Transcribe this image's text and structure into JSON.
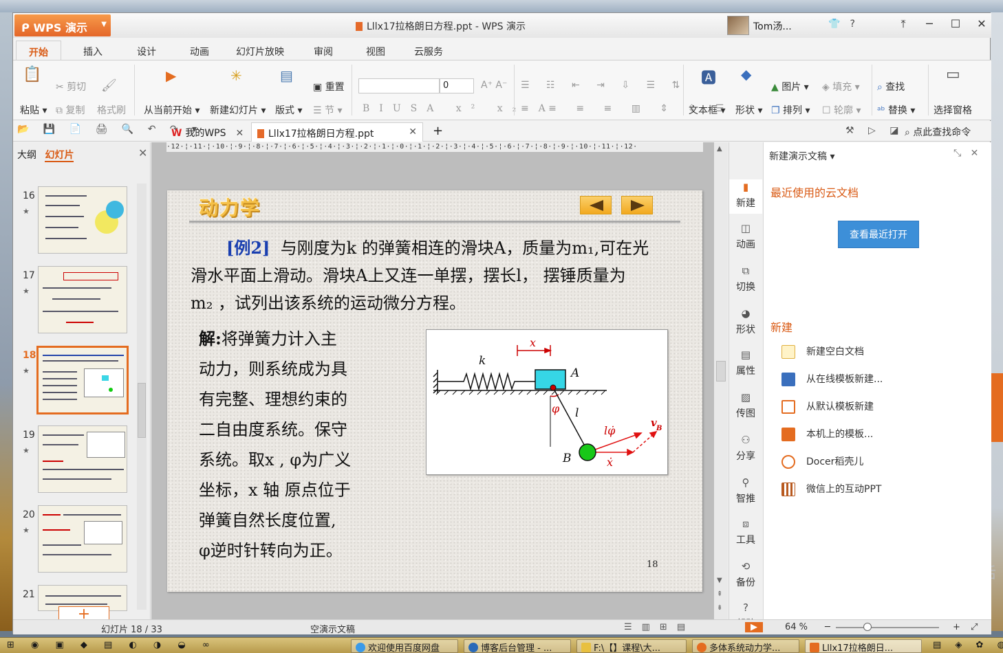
{
  "window": {
    "app_name": "WPS 演示",
    "title": "Lllx17拉格朗日方程.ppt - WPS 演示",
    "user_name": "Tom汤..."
  },
  "menu_tabs": [
    "开始",
    "插入",
    "设计",
    "动画",
    "幻灯片放映",
    "审阅",
    "视图",
    "云服务"
  ],
  "ribbon": {
    "paste": "粘贴",
    "cut": "剪切",
    "copy": "复制",
    "format_painter": "格式刷",
    "from_current": "从当前开始",
    "new_slide": "新建幻灯片",
    "layout": "版式",
    "reset": "重置",
    "section": "节",
    "font_size": "0",
    "textbox": "文本框",
    "shape": "形状",
    "picture": "图片",
    "fill": "填充",
    "arrange": "排列",
    "outline": "轮廓",
    "find": "查找",
    "replace": "替换",
    "select_pane": "选择窗格"
  },
  "doc_tabs": {
    "home": "我的WPS",
    "doc": "Lllx17拉格朗日方程.ppt",
    "search": "点此查找命令"
  },
  "left_panel": {
    "tab_outline": "大纲",
    "tab_slides": "幻灯片",
    "slides": [
      {
        "num": "16"
      },
      {
        "num": "17"
      },
      {
        "num": "18"
      },
      {
        "num": "19"
      },
      {
        "num": "20"
      },
      {
        "num": "21"
      }
    ]
  },
  "slide": {
    "title": "动力学",
    "example_label": "[例2]",
    "line1": "与刚度为k 的弹簧相连的滑块A，质量为m₁,可在光",
    "line2": "滑水平面上滑动。滑块A上又连一单摆，摆长l， 摆锤质量为",
    "line3": "m₂ ，试列出该系统的运动微分方程。",
    "sol_label": "解:",
    "sol_lines": [
      "将弹簧力计入主",
      "动力，则系统成为具",
      "有完整、理想约束的",
      "二自由度系统。保守",
      "系统。取x , φ为广义",
      "坐标，x 轴 原点位于",
      "弹簧自然长度位置,",
      "φ逆时针转向为正。"
    ],
    "page_number": "18",
    "figure": {
      "k": "k",
      "x": "x",
      "A": "A",
      "phi": "φ",
      "l": "l",
      "B": "B",
      "lphi": "lφ̇",
      "xdot": "ẋ",
      "vB": "v",
      "vB_sub": "B"
    }
  },
  "side_icons": [
    "新建",
    "动画",
    "切换",
    "形状",
    "属性",
    "传图",
    "分享",
    "智推",
    "工具",
    "备份",
    "帮助"
  ],
  "task_pane": {
    "header": "新建演示文稿",
    "recent": "最近使用的云文档",
    "view_recent": "查看最近打开",
    "new": "新建",
    "items": [
      "新建空白文档",
      "从在线模板新建...",
      "从默认模板新建",
      "本机上的模板...",
      "Docer稻壳儿",
      "微信上的互动PPT"
    ]
  },
  "status": {
    "slide_pos": "幻灯片 18 / 33",
    "template": "空演示文稿",
    "zoom": "64 %"
  },
  "taskbar": {
    "items": [
      "欢迎使用百度网盘",
      "博客后台管理 - ...",
      "F:\\【】课程\\大...",
      "多体系统动力学...",
      "Lllx17拉格朗日..."
    ]
  },
  "watermark": {
    "line1": "激活",
    "line2": "转到"
  },
  "colors": {
    "accent": "#e46c20",
    "blue_button": "#3d8fd8",
    "slide_title": "#f5c048"
  }
}
